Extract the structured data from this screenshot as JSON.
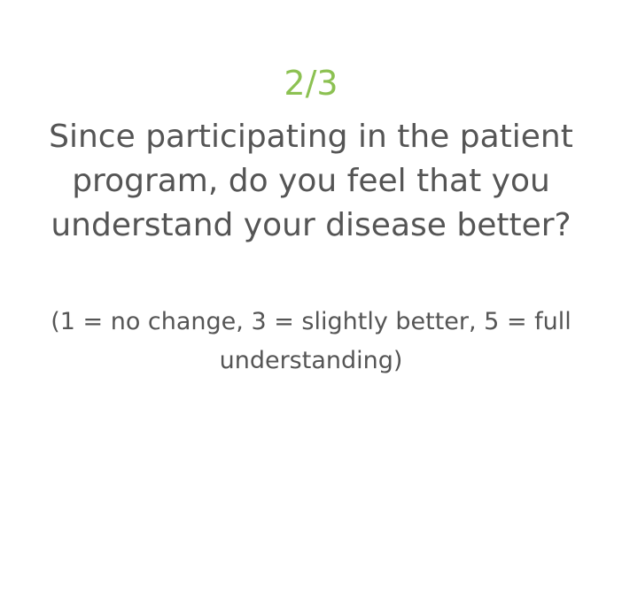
{
  "survey": {
    "progress": "2/3",
    "question": "Since participating in the patient program, do you feel that you understand your disease better?",
    "hint": "(1 = no change, 3 = slightly better, 5 = full understanding)"
  },
  "colors": {
    "accent": "#8cc152",
    "text": "#555555",
    "background": "#ffffff"
  }
}
